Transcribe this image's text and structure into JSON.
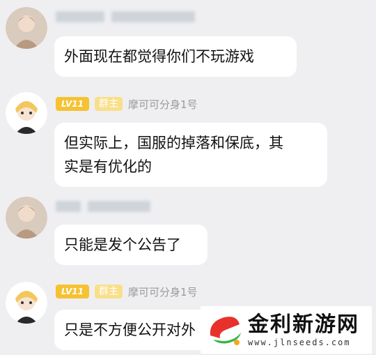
{
  "messages": [
    {
      "sender_blurred": true,
      "text": "外面现在都觉得你们不玩游戏"
    },
    {
      "sender_blurred": false,
      "level": "LV11",
      "role": "群主",
      "sender": "摩可可分身1号",
      "text_line1": "但实际上，国服的掉落和保底，其",
      "text_line2": "实是有优化的"
    },
    {
      "sender_blurred": true,
      "text": "只能是发个公告了"
    },
    {
      "sender_blurred": false,
      "level": "LV11",
      "role": "群主",
      "sender": "摩可可分身1号",
      "text": "只是不方便公开对外"
    }
  ],
  "watermark": {
    "name": "金利新游网",
    "url": "www.jlnseeds.com",
    "colors": {
      "red": "#e8312a",
      "green": "#3cb54a",
      "orange": "#f5a623"
    }
  }
}
